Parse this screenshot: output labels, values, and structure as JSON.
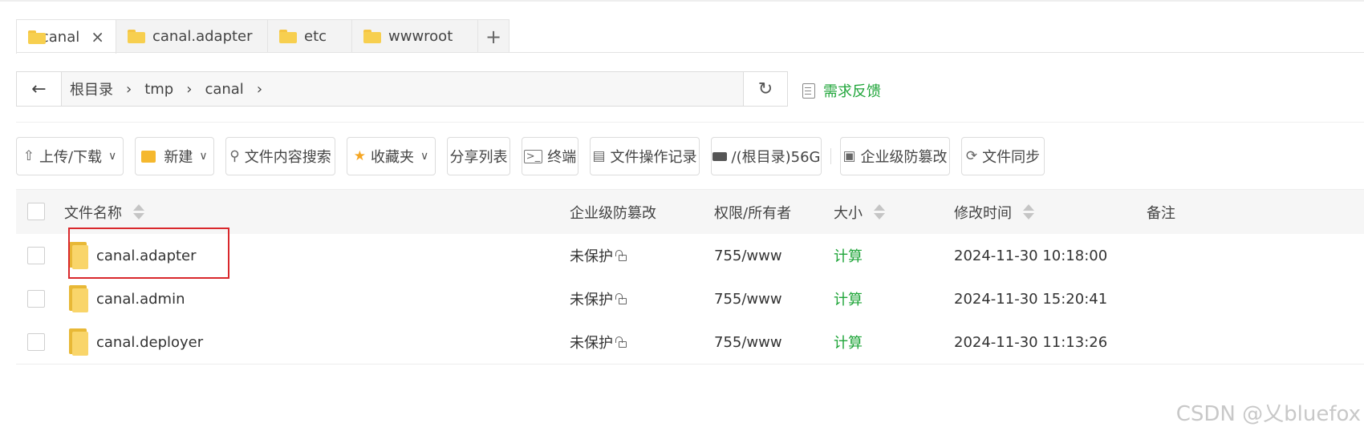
{
  "tabs": [
    {
      "label": "canal",
      "active": true,
      "closable": true
    },
    {
      "label": "canal.adapter",
      "active": false
    },
    {
      "label": "etc",
      "active": false
    },
    {
      "label": "wwwroot",
      "active": false
    }
  ],
  "tab_add_label": "+",
  "tab_close_label": "×",
  "nav": {
    "back_icon": "←",
    "breadcrumbs": [
      "根目录",
      "tmp",
      "canal"
    ],
    "separator": "›",
    "refresh_icon": "↻",
    "feedback_label": "需求反馈"
  },
  "toolbar": {
    "upload_download": "上传/下载",
    "new": "新建",
    "search_content": "文件内容搜索",
    "favorites": "收藏夹",
    "share_list": "分享列表",
    "terminal": "终端",
    "file_op_log": "文件操作记录",
    "disk": "/(根目录)56G",
    "tamper_proof": "企业级防篡改",
    "file_sync": "文件同步"
  },
  "table": {
    "headers": {
      "name": "文件名称",
      "tamper": "企业级防篡改",
      "perm_owner": "权限/所有者",
      "size": "大小",
      "mtime": "修改时间",
      "note": "备注"
    },
    "rows": [
      {
        "name": "canal.adapter",
        "tamper": "未保护",
        "perm": "755/www",
        "size": "计算",
        "mtime": "2024-11-30 10:18:00",
        "highlighted": true
      },
      {
        "name": "canal.admin",
        "tamper": "未保护",
        "perm": "755/www",
        "size": "计算",
        "mtime": "2024-11-30 15:20:41"
      },
      {
        "name": "canal.deployer",
        "tamper": "未保护",
        "perm": "755/www",
        "size": "计算",
        "mtime": "2024-11-30 11:13:26"
      }
    ]
  },
  "colors": {
    "accent_green": "#20a53a",
    "highlight_red": "#d9282c",
    "folder_yellow": "#f7cf4f"
  },
  "watermark": "CSDN @乂bluefox"
}
